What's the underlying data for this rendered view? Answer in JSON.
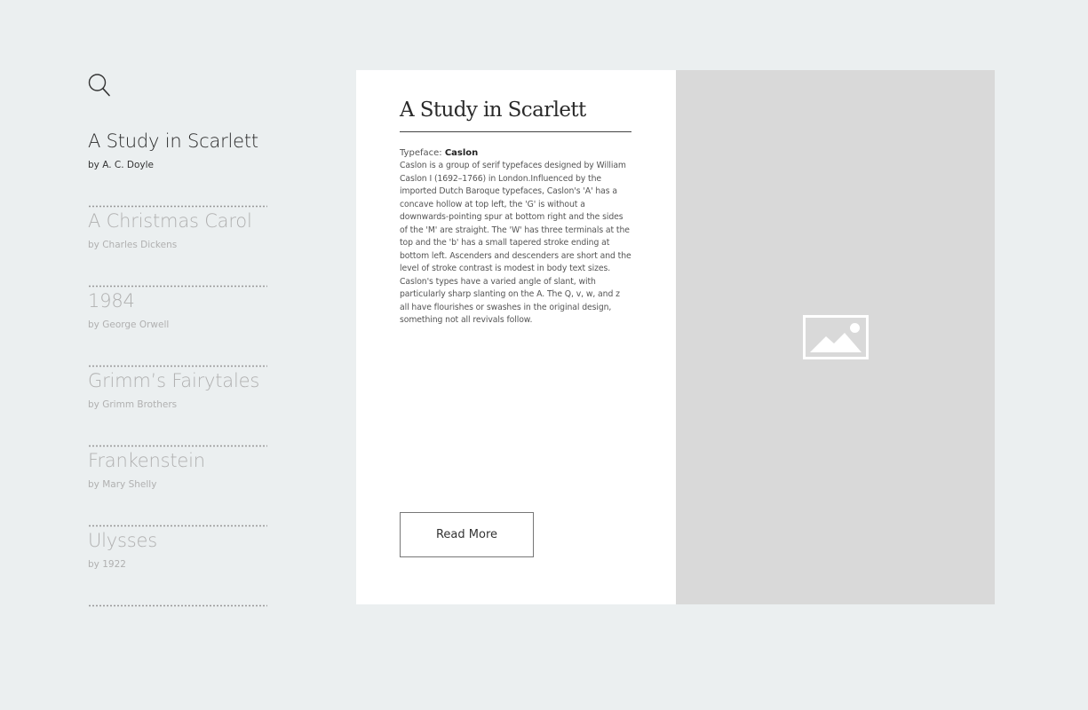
{
  "sidebar": {
    "search_icon": "search-icon",
    "books": [
      {
        "title": "A Study in Scarlett",
        "author": "by A. C. Doyle",
        "active": true
      },
      {
        "title": "A Christmas Carol",
        "author": "by Charles Dickens",
        "active": false
      },
      {
        "title": "1984",
        "author": "by George Orwell",
        "active": false
      },
      {
        "title": "Grimm’s Fairytales",
        "author": "by Grimm Brothers",
        "active": false
      },
      {
        "title": "Frankenstein",
        "author": "by Mary Shelly",
        "active": false
      },
      {
        "title": "Ulysses",
        "author": "by 1922",
        "active": false
      }
    ]
  },
  "detail": {
    "title": "A Study in Scarlett",
    "typeface_label": "Typeface:",
    "typeface_name": "Caslon",
    "description": "Caslon is a group of serif typefaces designed by William Caslon I (1692–1766) in London.Influenced by the imported Dutch Baroque typefaces, Caslon's 'A' has a concave hollow at top left, the 'G' is without a downwards-pointing spur at bottom right and the sides of the 'M' are straight. The 'W' has three terminals at the top and the 'b' has a small tapered stroke ending at bottom left. Ascenders and descenders are short and the level of stroke contrast is modest in body text sizes. Caslon's types have a varied angle of slant, with particularly sharp slanting on the A. The Q, v, w, and z all have flourishes or swashes in the original design, something not all revivals follow.",
    "read_more_label": "Read More",
    "image_icon": "image-placeholder-icon"
  },
  "colors": {
    "page_background": "#ebeff0",
    "card_text_background": "#ffffff",
    "image_background": "#d9d9d9",
    "active_text": "#2a2a2a",
    "inactive_text": "#b0b0b0"
  }
}
